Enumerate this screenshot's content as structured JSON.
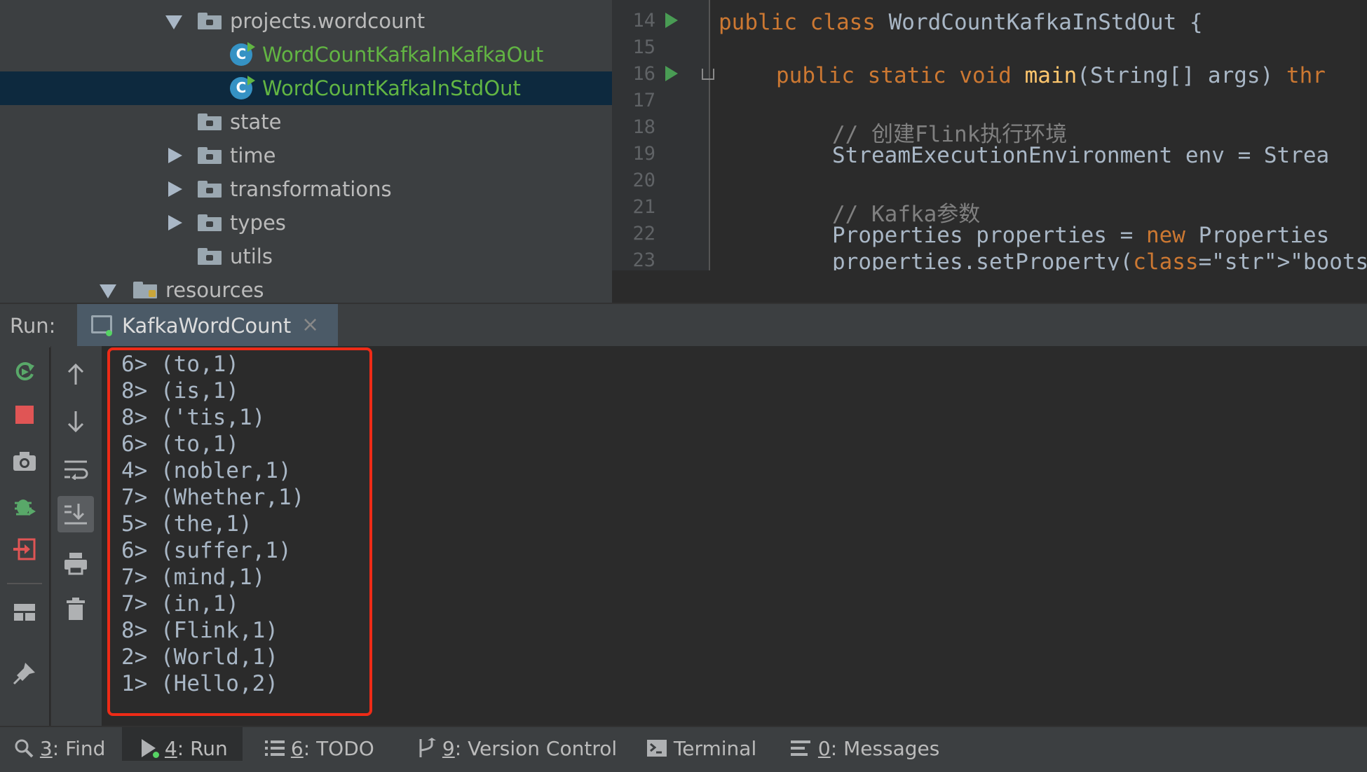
{
  "tree": {
    "items": [
      {
        "label": "projects.wordcount",
        "type": "folder",
        "expanded": true
      },
      {
        "label": "WordCountKafkaInKafkaOut",
        "type": "class"
      },
      {
        "label": "WordCountKafkaInStdOut",
        "type": "class",
        "selected": true
      },
      {
        "label": "state",
        "type": "folder"
      },
      {
        "label": "time",
        "type": "folder",
        "collapsed": true
      },
      {
        "label": "transformations",
        "type": "folder",
        "collapsed": true
      },
      {
        "label": "types",
        "type": "folder",
        "collapsed": true
      },
      {
        "label": "utils",
        "type": "folder"
      },
      {
        "label": "resources",
        "type": "resources-folder",
        "expanded": true
      }
    ]
  },
  "editor": {
    "lines": [
      {
        "n": "14",
        "code": "public class WordCountKafkaInStdOut {"
      },
      {
        "n": "15",
        "code": ""
      },
      {
        "n": "16",
        "code": "public static void main(String[] args) thr"
      },
      {
        "n": "17",
        "code": ""
      },
      {
        "n": "18",
        "code": "// 创建Flink执行环境"
      },
      {
        "n": "19",
        "code": "StreamExecutionEnvironment env = Strea"
      },
      {
        "n": "20",
        "code": ""
      },
      {
        "n": "21",
        "code": "// Kafka参数"
      },
      {
        "n": "22",
        "code": "Properties properties = new Properties"
      },
      {
        "n": "23",
        "code": "properties.setProperty(\"bootstrap.serv"
      }
    ]
  },
  "run_panel": {
    "label": "Run:",
    "tab_title": "KafkaWordCount",
    "close_glyph": "×"
  },
  "console": {
    "lines": [
      "6> (to,1)",
      "8> (is,1)",
      "8> ('tis,1)",
      "6> (to,1)",
      "4> (nobler,1)",
      "7> (Whether,1)",
      "5> (the,1)",
      "6> (suffer,1)",
      "7> (mind,1)",
      "7> (in,1)",
      "8> (Flink,1)",
      "2> (World,1)",
      "1> (Hello,2)"
    ]
  },
  "bottom_bar": {
    "find": {
      "key": "3",
      "label": ": Find"
    },
    "run": {
      "key": "4",
      "label": ": Run"
    },
    "todo": {
      "key": "6",
      "label": ": TODO"
    },
    "vcs": {
      "key": "9",
      "label": ": Version Control"
    },
    "terminal": {
      "label": "Terminal"
    },
    "messages": {
      "key": "0",
      "label": ": Messages"
    }
  },
  "colors": {
    "accent_green": "#62b543",
    "highlight_box": "#ee2b17",
    "selection": "#0d293e"
  }
}
